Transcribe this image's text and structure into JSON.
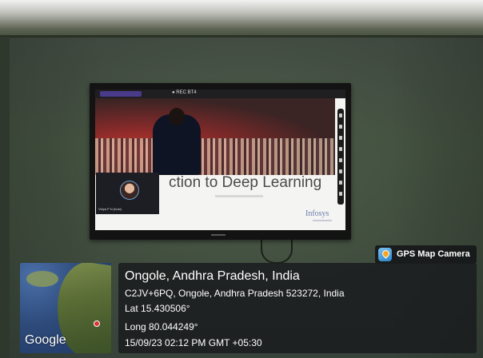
{
  "screen": {
    "meeting_title": "● REC BT4",
    "slide_title": "ction to Deep Learning",
    "slide_logo": "Infosys",
    "presenter_name": "Vidya P N (host)"
  },
  "badge": {
    "icon": "gps-map-camera-icon",
    "label": "GPS Map Camera"
  },
  "map": {
    "attribution": "Google"
  },
  "location": {
    "place": "Ongole, Andhra Pradesh, India",
    "address": "C2JV+6PQ, Ongole, Andhra Pradesh 523272, India",
    "latitude": "Lat 15.430506°",
    "longitude": "Long 80.044249°",
    "timestamp": "15/09/23 02:12 PM GMT +05:30"
  },
  "colors": {
    "overlay_background": "#1a1c1e",
    "overlay_text": "#ffffff",
    "wall": "#42503f"
  }
}
